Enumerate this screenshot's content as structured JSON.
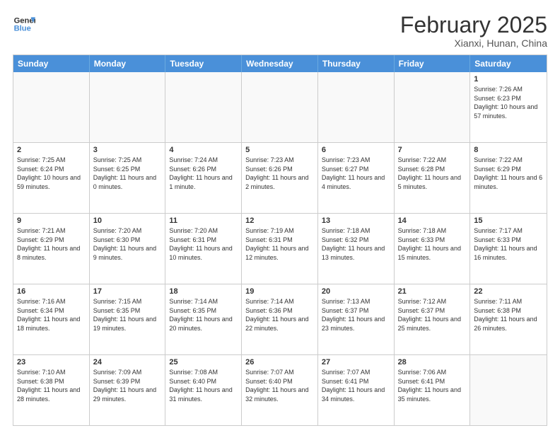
{
  "header": {
    "logo_line1": "General",
    "logo_line2": "Blue",
    "month_title": "February 2025",
    "location": "Xianxi, Hunan, China"
  },
  "weekdays": [
    "Sunday",
    "Monday",
    "Tuesday",
    "Wednesday",
    "Thursday",
    "Friday",
    "Saturday"
  ],
  "rows": [
    [
      {
        "day": "",
        "info": ""
      },
      {
        "day": "",
        "info": ""
      },
      {
        "day": "",
        "info": ""
      },
      {
        "day": "",
        "info": ""
      },
      {
        "day": "",
        "info": ""
      },
      {
        "day": "",
        "info": ""
      },
      {
        "day": "1",
        "info": "Sunrise: 7:26 AM\nSunset: 6:23 PM\nDaylight: 10 hours and 57 minutes."
      }
    ],
    [
      {
        "day": "2",
        "info": "Sunrise: 7:25 AM\nSunset: 6:24 PM\nDaylight: 10 hours and 59 minutes."
      },
      {
        "day": "3",
        "info": "Sunrise: 7:25 AM\nSunset: 6:25 PM\nDaylight: 11 hours and 0 minutes."
      },
      {
        "day": "4",
        "info": "Sunrise: 7:24 AM\nSunset: 6:26 PM\nDaylight: 11 hours and 1 minute."
      },
      {
        "day": "5",
        "info": "Sunrise: 7:23 AM\nSunset: 6:26 PM\nDaylight: 11 hours and 2 minutes."
      },
      {
        "day": "6",
        "info": "Sunrise: 7:23 AM\nSunset: 6:27 PM\nDaylight: 11 hours and 4 minutes."
      },
      {
        "day": "7",
        "info": "Sunrise: 7:22 AM\nSunset: 6:28 PM\nDaylight: 11 hours and 5 minutes."
      },
      {
        "day": "8",
        "info": "Sunrise: 7:22 AM\nSunset: 6:29 PM\nDaylight: 11 hours and 6 minutes."
      }
    ],
    [
      {
        "day": "9",
        "info": "Sunrise: 7:21 AM\nSunset: 6:29 PM\nDaylight: 11 hours and 8 minutes."
      },
      {
        "day": "10",
        "info": "Sunrise: 7:20 AM\nSunset: 6:30 PM\nDaylight: 11 hours and 9 minutes."
      },
      {
        "day": "11",
        "info": "Sunrise: 7:20 AM\nSunset: 6:31 PM\nDaylight: 11 hours and 10 minutes."
      },
      {
        "day": "12",
        "info": "Sunrise: 7:19 AM\nSunset: 6:31 PM\nDaylight: 11 hours and 12 minutes."
      },
      {
        "day": "13",
        "info": "Sunrise: 7:18 AM\nSunset: 6:32 PM\nDaylight: 11 hours and 13 minutes."
      },
      {
        "day": "14",
        "info": "Sunrise: 7:18 AM\nSunset: 6:33 PM\nDaylight: 11 hours and 15 minutes."
      },
      {
        "day": "15",
        "info": "Sunrise: 7:17 AM\nSunset: 6:33 PM\nDaylight: 11 hours and 16 minutes."
      }
    ],
    [
      {
        "day": "16",
        "info": "Sunrise: 7:16 AM\nSunset: 6:34 PM\nDaylight: 11 hours and 18 minutes."
      },
      {
        "day": "17",
        "info": "Sunrise: 7:15 AM\nSunset: 6:35 PM\nDaylight: 11 hours and 19 minutes."
      },
      {
        "day": "18",
        "info": "Sunrise: 7:14 AM\nSunset: 6:35 PM\nDaylight: 11 hours and 20 minutes."
      },
      {
        "day": "19",
        "info": "Sunrise: 7:14 AM\nSunset: 6:36 PM\nDaylight: 11 hours and 22 minutes."
      },
      {
        "day": "20",
        "info": "Sunrise: 7:13 AM\nSunset: 6:37 PM\nDaylight: 11 hours and 23 minutes."
      },
      {
        "day": "21",
        "info": "Sunrise: 7:12 AM\nSunset: 6:37 PM\nDaylight: 11 hours and 25 minutes."
      },
      {
        "day": "22",
        "info": "Sunrise: 7:11 AM\nSunset: 6:38 PM\nDaylight: 11 hours and 26 minutes."
      }
    ],
    [
      {
        "day": "23",
        "info": "Sunrise: 7:10 AM\nSunset: 6:38 PM\nDaylight: 11 hours and 28 minutes."
      },
      {
        "day": "24",
        "info": "Sunrise: 7:09 AM\nSunset: 6:39 PM\nDaylight: 11 hours and 29 minutes."
      },
      {
        "day": "25",
        "info": "Sunrise: 7:08 AM\nSunset: 6:40 PM\nDaylight: 11 hours and 31 minutes."
      },
      {
        "day": "26",
        "info": "Sunrise: 7:07 AM\nSunset: 6:40 PM\nDaylight: 11 hours and 32 minutes."
      },
      {
        "day": "27",
        "info": "Sunrise: 7:07 AM\nSunset: 6:41 PM\nDaylight: 11 hours and 34 minutes."
      },
      {
        "day": "28",
        "info": "Sunrise: 7:06 AM\nSunset: 6:41 PM\nDaylight: 11 hours and 35 minutes."
      },
      {
        "day": "",
        "info": ""
      }
    ]
  ]
}
